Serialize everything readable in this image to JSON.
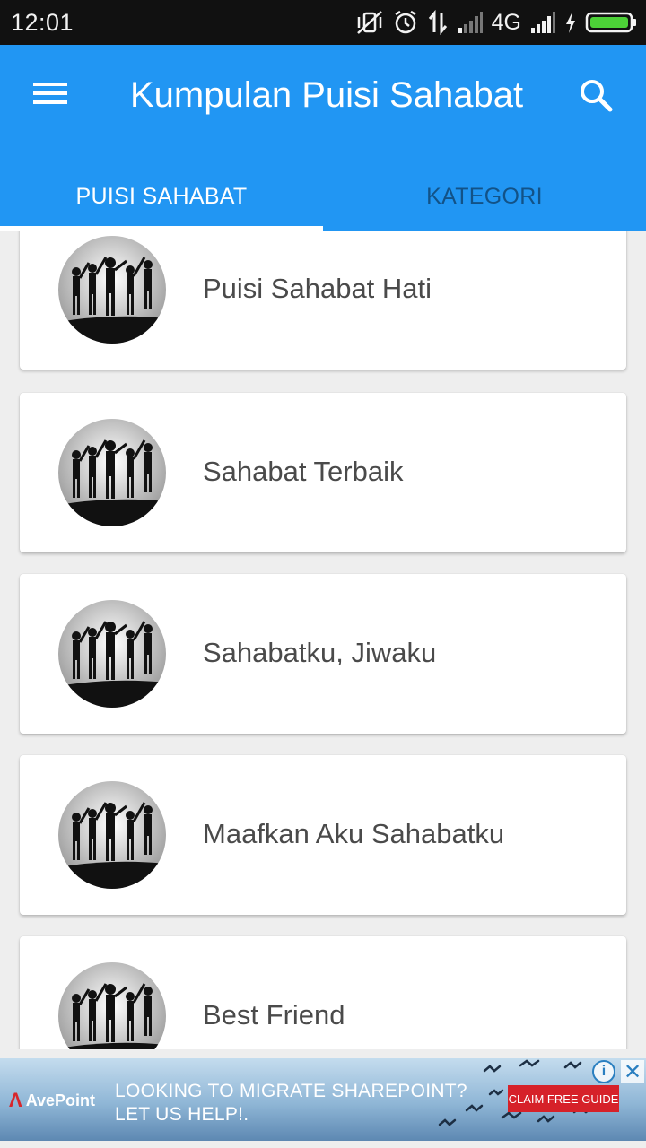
{
  "status_bar": {
    "time": "12:01",
    "network": "4G",
    "icons": [
      "vibrate-off-icon",
      "alarm-icon",
      "data-transfer-icon",
      "signal-weak-icon",
      "signal-strong-icon",
      "charging-icon",
      "battery-icon"
    ]
  },
  "app_bar": {
    "title": "Kumpulan Puisi Sahabat",
    "menu_icon": "hamburger-menu-icon",
    "search_icon": "search-icon",
    "color": "#2196f3"
  },
  "tabs": [
    {
      "label": "PUISI SAHABAT",
      "active": true
    },
    {
      "label": "KATEGORI",
      "active": false
    }
  ],
  "list": {
    "items": [
      {
        "title": "Puisi Sahabat Hati"
      },
      {
        "title": "Sahabat Terbaik"
      },
      {
        "title": "Sahabatku, Jiwaku"
      },
      {
        "title": "Maafkan Aku Sahabatku"
      },
      {
        "title": "Best Friend"
      }
    ]
  },
  "ad": {
    "brand": "AvePoint",
    "line1": "LOOKING TO MIGRATE SHAREPOINT?",
    "line2": "LET US HELP!.",
    "cta": "CLAIM FREE GUIDE",
    "info_icon": "ad-info-icon",
    "close_icon": "close-icon",
    "cta_color": "#d62129"
  }
}
